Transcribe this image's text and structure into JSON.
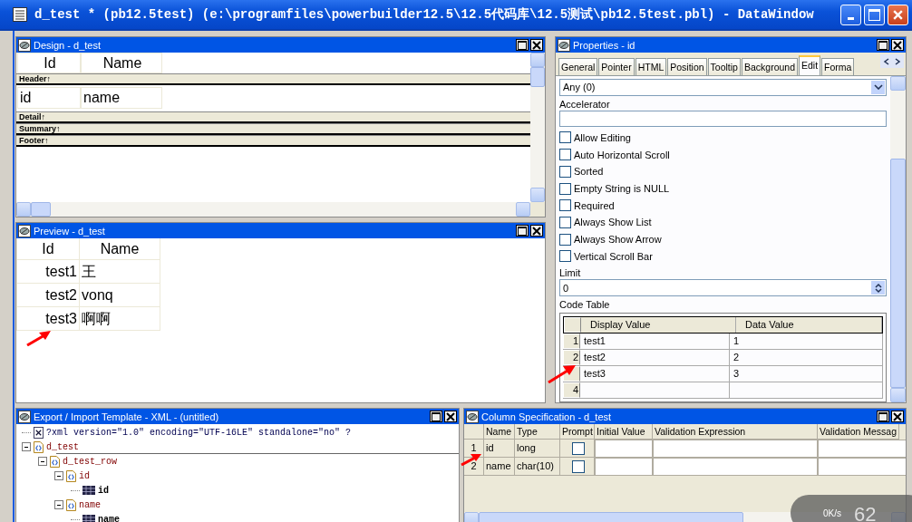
{
  "window": {
    "title": "d_test * (pb12.5test) (e:\\programfiles\\powerbuilder12.5\\12.5代码库\\12.5测试\\pb12.5test.pbl) - DataWindow"
  },
  "design": {
    "title": "Design - d_test",
    "header_labels": [
      "Id",
      "Name"
    ],
    "detail_fields": [
      "id",
      "name"
    ],
    "bands": [
      {
        "label": "Header↑"
      },
      {
        "label": "Detail↑"
      },
      {
        "label": "Summary↑"
      },
      {
        "label": "Footer↑"
      }
    ]
  },
  "preview": {
    "title": "Preview - d_test",
    "columns": [
      "Id",
      "Name"
    ],
    "rows": [
      {
        "id": "test1",
        "name": "王"
      },
      {
        "id": "test2",
        "name": "vonq"
      },
      {
        "id": "test3",
        "name": "啊啊"
      }
    ]
  },
  "properties": {
    "title": "Properties - id",
    "tabs": [
      {
        "label": "General",
        "selected": false
      },
      {
        "label": "Pointer",
        "selected": false
      },
      {
        "label": "HTML",
        "selected": false
      },
      {
        "label": "Position",
        "selected": false
      },
      {
        "label": "Tooltip",
        "selected": false
      },
      {
        "label": "Background",
        "selected": false
      },
      {
        "label": "Edit",
        "selected": true
      },
      {
        "label": "Forma",
        "selected": false
      }
    ],
    "style_value": "Any (0)",
    "accelerator_label": "Accelerator",
    "options": [
      {
        "label": "Allow Editing",
        "checked": false
      },
      {
        "label": "Auto Horizontal Scroll",
        "checked": false
      },
      {
        "label": "Sorted",
        "checked": false
      },
      {
        "label": "Empty String is NULL",
        "checked": false
      },
      {
        "label": "Required",
        "checked": false
      },
      {
        "label": "Always Show List",
        "checked": false
      },
      {
        "label": "Always Show Arrow",
        "checked": false
      },
      {
        "label": "Vertical Scroll Bar",
        "checked": false
      }
    ],
    "limit_label": "Limit",
    "limit_value": "0",
    "code_table_label": "Code Table",
    "code_table": {
      "columns": [
        "Display Value",
        "Data Value"
      ],
      "rows": [
        {
          "number": "1",
          "display": "test1",
          "data": "1"
        },
        {
          "number": "2",
          "display": "test2",
          "data": "2"
        },
        {
          "number": "",
          "display": "test3",
          "data": "3"
        },
        {
          "number": "4",
          "display": "",
          "data": ""
        }
      ]
    }
  },
  "export": {
    "title": "Export / Import Template - XML - (untitled)",
    "tree": [
      {
        "kind": "declaration",
        "text": "?xml version=\"1.0\" encoding=\"UTF-16LE\" standalone=\"no\" ?"
      },
      {
        "kind": "element",
        "text": "d_test",
        "children": [
          {
            "kind": "element",
            "text": "d_test_row",
            "children": [
              {
                "kind": "element",
                "text": "id",
                "children": [
                  {
                    "kind": "column",
                    "text": "id"
                  }
                ]
              },
              {
                "kind": "element",
                "text": "name",
                "children": [
                  {
                    "kind": "column",
                    "text": "name"
                  }
                ]
              }
            ]
          }
        ]
      }
    ]
  },
  "column_spec": {
    "title": "Column Specification - d_test",
    "columns": [
      "Name",
      "Type",
      "Prompt",
      "Initial Value",
      "Validation Expression",
      "Validation Messag"
    ],
    "rows": [
      {
        "number": "1",
        "name": "id",
        "type": "long",
        "prompt": false
      },
      {
        "number": "2",
        "name": "name",
        "type": "char(10)",
        "prompt": false
      }
    ]
  },
  "speed_widget": {
    "rate": "0K/s",
    "value": "62"
  }
}
